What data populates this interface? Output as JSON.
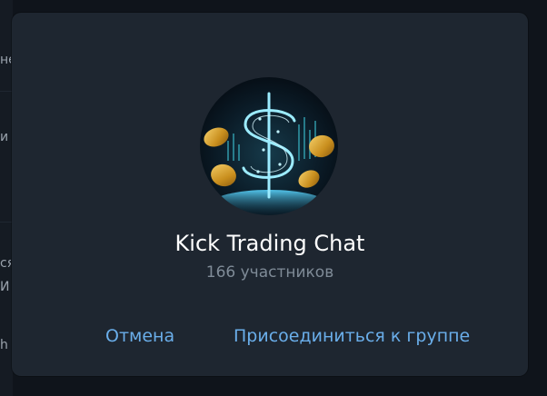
{
  "background": {
    "snippets": [
      "не",
      "и",
      "ся",
      "И",
      "h"
    ]
  },
  "dialog": {
    "group_name": "Kick Trading Chat",
    "member_count": "166 участников",
    "avatar_icon": "dollar-sign-icon",
    "cancel_label": "Отмена",
    "join_label": "Присоединиться к группе"
  },
  "colors": {
    "dialog_bg": "#1e2630",
    "accent": "#6aaeea",
    "title": "#ffffff",
    "subtitle": "#7f8b97",
    "gold": "#d9a531",
    "cyan": "#7fe3ff"
  }
}
